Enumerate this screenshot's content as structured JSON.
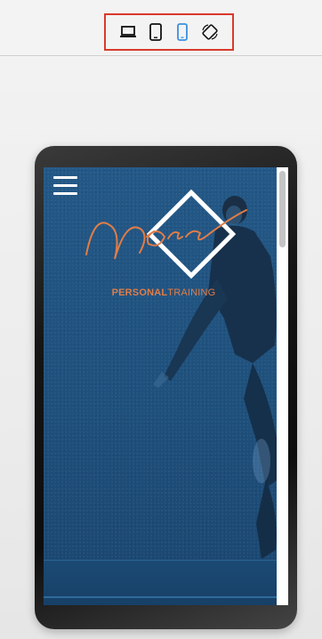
{
  "toolbar": {
    "devices": [
      {
        "name": "desktop",
        "icon": "laptop-icon",
        "active": false
      },
      {
        "name": "tablet",
        "icon": "tablet-icon",
        "active": false
      },
      {
        "name": "mobile",
        "icon": "mobile-icon",
        "active": true
      },
      {
        "name": "rotate",
        "icon": "rotate-icon",
        "active": false
      }
    ],
    "highlight_color": "#d93a2b",
    "active_color": "#3b8fe0"
  },
  "preview": {
    "brand": {
      "script_name": "Nora",
      "subtitle_bold": "PERSONAL",
      "subtitle_light": "TRAINING",
      "accent_color": "#e07d48"
    },
    "menu_icon": "hamburger-icon",
    "hero_color": "#1f4f79"
  }
}
